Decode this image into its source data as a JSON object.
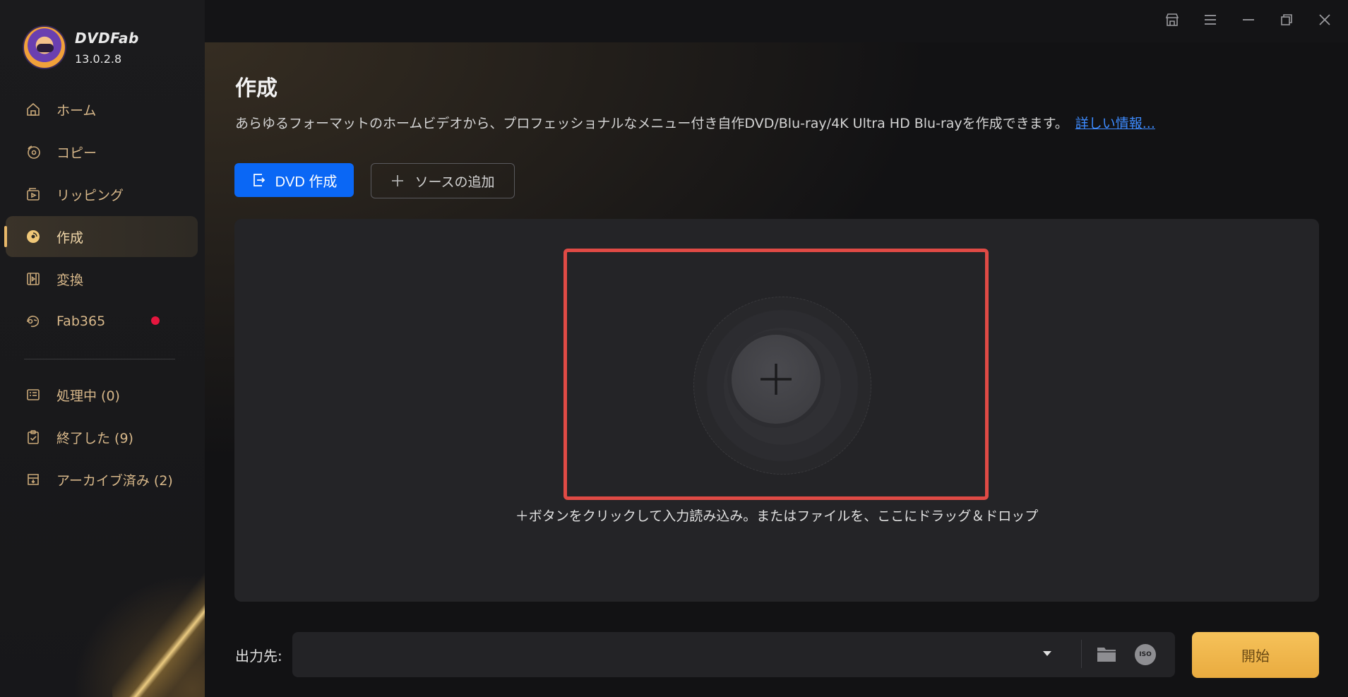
{
  "app": {
    "name": "DVDFab",
    "version": "13.0.2.8"
  },
  "sidebar": {
    "items": [
      {
        "label": "ホーム",
        "icon": "home-icon"
      },
      {
        "label": "コピー",
        "icon": "copy-disc-icon"
      },
      {
        "label": "リッピング",
        "icon": "ripping-icon"
      },
      {
        "label": "作成",
        "icon": "create-disc-icon",
        "active": true
      },
      {
        "label": "変換",
        "icon": "film-icon"
      },
      {
        "label": "Fab365",
        "icon": "fab365-icon",
        "badge_color": "#e5163e"
      }
    ],
    "queue": [
      {
        "label": "処理中 (0)",
        "icon": "processing-list-icon"
      },
      {
        "label": "終了した (9)",
        "icon": "finished-clipboard-icon"
      },
      {
        "label": "アーカイブ済み (2)",
        "icon": "archive-box-icon"
      }
    ]
  },
  "window_controls": [
    "shop-icon",
    "menu-icon",
    "minimize-icon",
    "restore-icon",
    "close-icon"
  ],
  "main": {
    "title": "作成",
    "description": "あらゆるフォーマットのホームビデオから、プロフェッショナルなメニュー付き自作DVD/Blu-ray/4K Ultra HD Blu-rayを作成できます。",
    "more_link": "詳しい情報...",
    "primary_button": "DVD 作成",
    "add_source_button": "ソースの追加",
    "drop_hint": "＋ボタンをクリックして入力読み込み。またはファイルを、ここにドラッグ＆ドロップ"
  },
  "output": {
    "label": "出力先:",
    "value": "",
    "iso_label": "ISO",
    "start_button": "開始"
  },
  "colors": {
    "accent_blue": "#0a67f5",
    "accent_gold": "#f6c25a",
    "highlight_red": "#e04a45",
    "sidebar_text": "#d8b88a"
  }
}
